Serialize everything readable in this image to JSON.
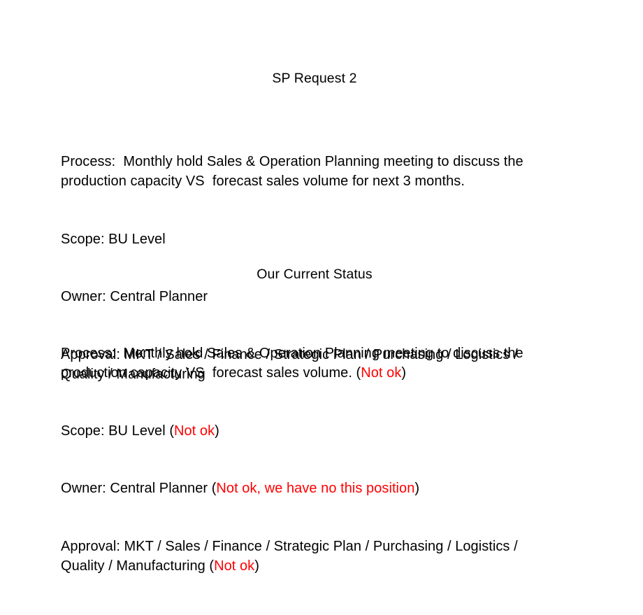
{
  "document": {
    "background_color": "#ffffff",
    "text_color": "#000000",
    "flag_color": "#ff0000"
  },
  "request_section": {
    "heading": "SP Request 2",
    "lines": {
      "process": "Process:  Monthly hold Sales & Operation Planning meeting to discuss the production capacity VS  forecast sales volume for next 3 months.",
      "scope": "Scope: BU Level",
      "owner": "Owner: Central Planner",
      "approval": "Approval: MKT / Sales / Finance / Strategic Plan / Purchasing / Logistics / Quality / Manufacturing"
    }
  },
  "status_section": {
    "heading": "Our Current Status",
    "lines": {
      "process_text": "Process:  Monthly hold Sales & Operation Planning meeting to discuss the production capacity VS  forecast sales volume. (",
      "process_flag": "Not ok",
      "process_tail": ")",
      "scope_text": "Scope: BU Level (",
      "scope_flag": "Not ok",
      "scope_tail": ")",
      "owner_text": "Owner: Central Planner (",
      "owner_flag": "Not ok, we have no this position",
      "owner_tail": ")",
      "approval_text": "Approval: MKT / Sales / Finance / Strategic Plan / Purchasing / Logistics / Quality / Manufacturing (",
      "approval_flag": "Not ok",
      "approval_tail": ")"
    }
  }
}
